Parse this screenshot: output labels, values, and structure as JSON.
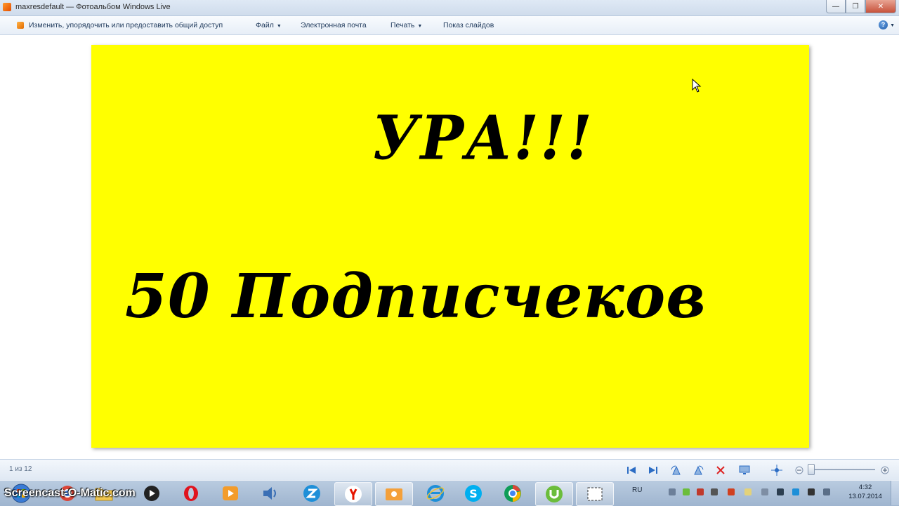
{
  "window": {
    "title": "maxresdefault — Фотоальбом Windows Live",
    "minimize": "—",
    "maximize": "❐",
    "close": "✕"
  },
  "menu": {
    "edit_share": "Изменить, упорядочить или предоставить общий доступ",
    "file": "Файл",
    "email": "Электронная почта",
    "print": "Печать",
    "slideshow": "Показ слайдов",
    "help": "?"
  },
  "photo": {
    "background": "#ffff00",
    "line1": "УРА!!!",
    "line2": "50  Подписчеков"
  },
  "status": {
    "counter": "1 из 12"
  },
  "taskbar": {
    "watermark": "Screencast-O-Matic.com",
    "language": "RU",
    "time": "4:32",
    "date": "13.07.2014",
    "apps": [
      "start-orb",
      "chrome-app",
      "opera-app",
      "media-player-app",
      "volume-app",
      "zona-app",
      "yandex-app",
      "photo-gallery-app",
      "ie-app",
      "skype-app",
      "chrome-browser-app",
      "utorrent-app",
      "snipping-tool-app"
    ]
  }
}
